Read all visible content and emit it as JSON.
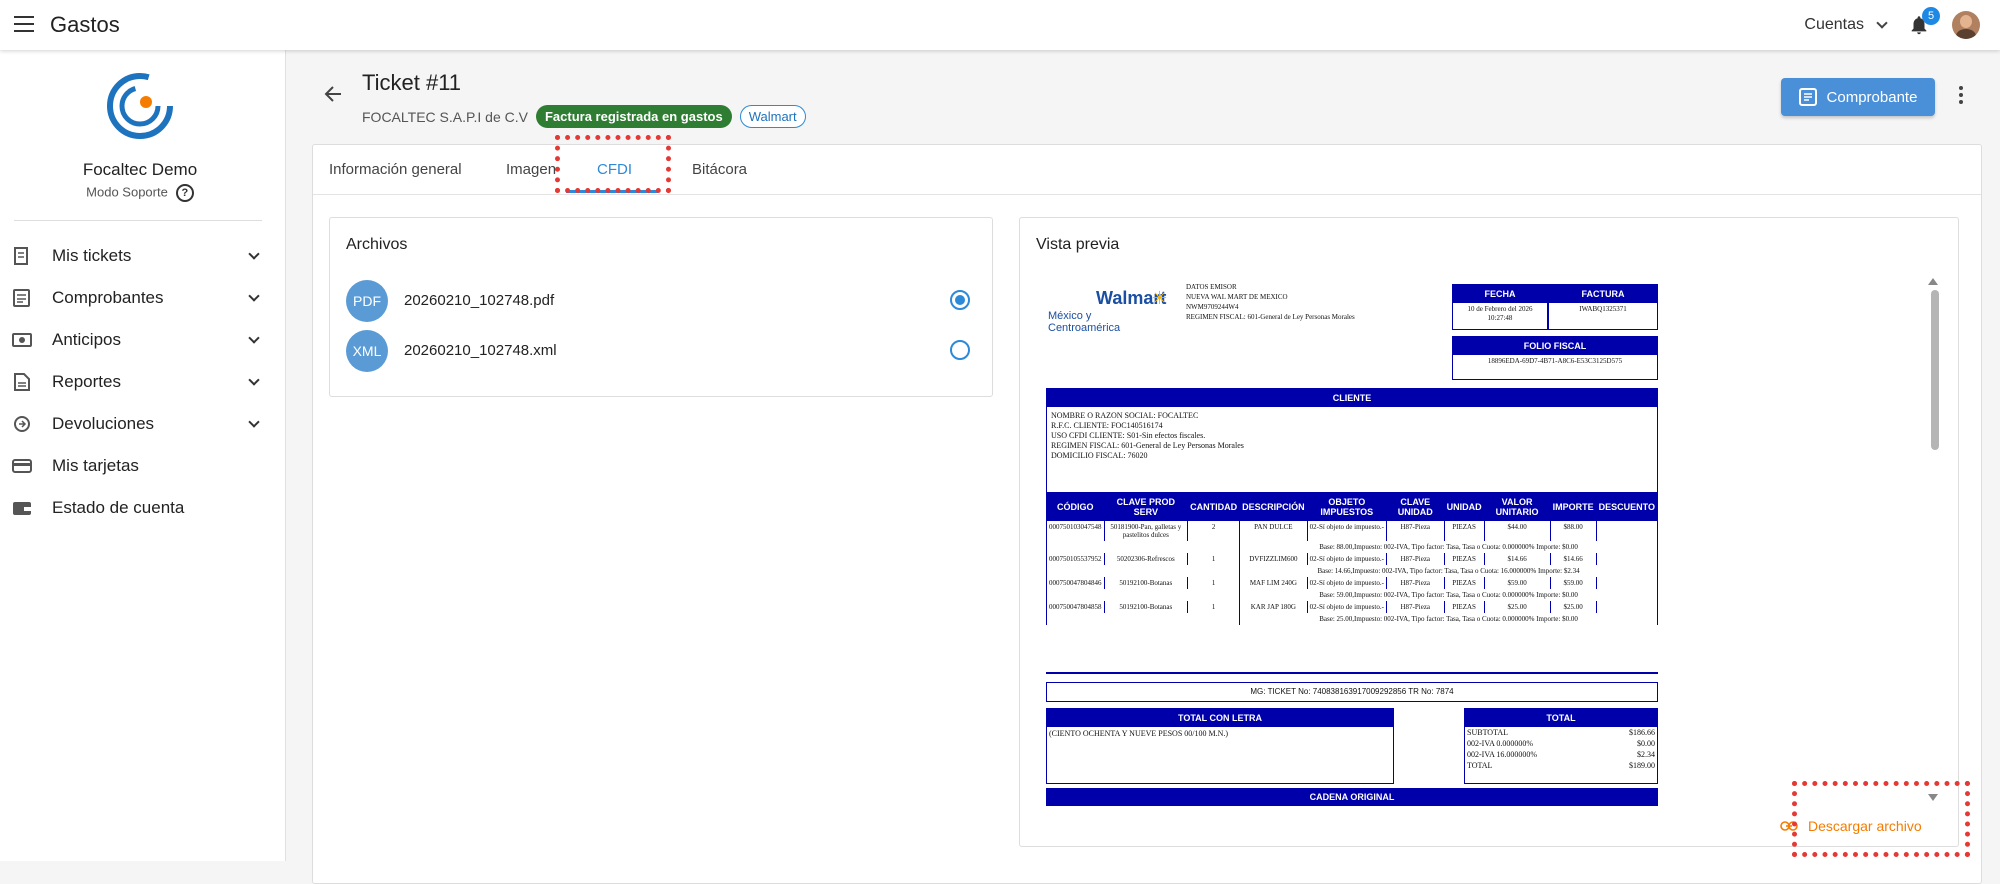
{
  "app": {
    "title": "Gastos"
  },
  "topbar": {
    "accounts_label": "Cuentas",
    "notifications_count": "5"
  },
  "sidebar": {
    "org_name": "Focaltec Demo",
    "mode": "Modo Soporte",
    "help": "?",
    "items": [
      {
        "label": "Mis tickets",
        "icon": "receipt-icon",
        "expandable": true
      },
      {
        "label": "Comprobantes",
        "icon": "document-icon",
        "expandable": true
      },
      {
        "label": "Anticipos",
        "icon": "cash-icon",
        "expandable": true
      },
      {
        "label": "Reportes",
        "icon": "report-icon",
        "expandable": true
      },
      {
        "label": "Devoluciones",
        "icon": "refund-icon",
        "expandable": true
      },
      {
        "label": "Mis tarjetas",
        "icon": "card-icon",
        "expandable": false
      },
      {
        "label": "Estado de cuenta",
        "icon": "wallet-icon",
        "expandable": false
      }
    ]
  },
  "header": {
    "title": "Ticket #11",
    "company": "FOCALTEC S.A.P.I de C.V",
    "status_chip": "Factura registrada en gastos",
    "vendor_chip": "Walmart",
    "comprobante_button": "Comprobante"
  },
  "tabs": [
    {
      "label": "Información general",
      "active": false
    },
    {
      "label": "Imagen",
      "active": false
    },
    {
      "label": "CFDI",
      "active": true
    },
    {
      "label": "Bitácora",
      "active": false
    }
  ],
  "files": {
    "title": "Archivos",
    "items": [
      {
        "type": "PDF",
        "name": "20260210_102748.pdf",
        "selected": true
      },
      {
        "type": "XML",
        "name": "20260210_102748.xml",
        "selected": false
      }
    ]
  },
  "preview": {
    "title": "Vista previa",
    "download_label": "Descargar archivo",
    "invoice": {
      "logo_text": "Walmart",
      "logo_sub": "México y Centroamérica",
      "emisor_lines": [
        "DATOS EMISOR",
        "NUEVA WAL MART DE MEXICO",
        "NWM9709244W4",
        "REGIMEN FISCAL: 601-General de Ley Personas Morales"
      ],
      "fecha_label": "FECHA",
      "fecha_value": "10 de Febrero del 2026 10:27:48",
      "factura_label": "FACTURA",
      "factura_value": "IWABQ1325371",
      "folio_label": "FOLIO FISCAL",
      "folio_value": "18896EDA-69D7-4B71-A8C6-E53C3125D575",
      "cliente_label": "CLIENTE",
      "cliente_lines": [
        "NOMBRE O RAZON SOCIAL: FOCALTEC",
        "R.F.C. CLIENTE: FOC140516174",
        "USO CFDI CLIENTE: S01-Sin efectos fiscales.",
        "REGIMEN FISCAL: 601-General de Ley Personas Morales",
        "DOMICILIO FISCAL: 76020"
      ],
      "columns": [
        "CÓDIGO",
        "CLAVE PROD SERV",
        "CANTIDAD",
        "DESCRIPCIÓN",
        "OBJETO IMPUESTOS",
        "CLAVE UNIDAD",
        "UNIDAD",
        "VALOR UNITARIO",
        "IMPORTE",
        "DESCUENTO"
      ],
      "rows": [
        {
          "codigo": "000750103047548",
          "clave": "50181900-Pan, galletas y pastelitos dulces",
          "cantidad": "2",
          "desc": "PAN DULCE",
          "objeto": "02-Sí objeto de impuesto.-",
          "clave_unidad": "H87-Pieza",
          "unidad": "PIEZAS",
          "valor": "$44.00",
          "importe": "$88.00",
          "descuento": "",
          "base": "Base: 88.00,Impuesto: 002-IVA, Tipo factor: Tasa, Tasa o Cuota: 0.000000% Importe: $0.00"
        },
        {
          "codigo": "000750105537952",
          "clave": "50202306-Refrescos",
          "cantidad": "1",
          "desc": "DVFIZZLIM600",
          "objeto": "02-Sí objeto de impuesto.-",
          "clave_unidad": "H87-Pieza",
          "unidad": "PIEZAS",
          "valor": "$14.66",
          "importe": "$14.66",
          "descuento": "",
          "base": "Base: 14.66,Impuesto: 002-IVA, Tipo factor: Tasa, Tasa o Cuota: 16.000000% Importe: $2.34"
        },
        {
          "codigo": "000750047804846",
          "clave": "50192100-Botanas",
          "cantidad": "1",
          "desc": "MAF LIM 240G",
          "objeto": "02-Sí objeto de impuesto.-",
          "clave_unidad": "H87-Pieza",
          "unidad": "PIEZAS",
          "valor": "$59.00",
          "importe": "$59.00",
          "descuento": "",
          "base": "Base: 59.00,Impuesto: 002-IVA, Tipo factor: Tasa, Tasa o Cuota: 0.000000% Importe: $0.00"
        },
        {
          "codigo": "000750047804858",
          "clave": "50192100-Botanas",
          "cantidad": "1",
          "desc": "KAR JAP 180G",
          "objeto": "02-Sí objeto de impuesto.-",
          "clave_unidad": "H87-Pieza",
          "unidad": "PIEZAS",
          "valor": "$25.00",
          "importe": "$25.00",
          "descuento": "",
          "base": "Base: 25.00,Impuesto: 002-IVA, Tipo factor: Tasa, Tasa o Cuota: 0.000000% Importe: $0.00"
        }
      ],
      "mg_line": "MG: TICKET No: 74083816391700929​2856 TR No: 7874",
      "letra_label": "TOTAL CON LETRA",
      "letra_value": "(CIENTO OCHENTA Y NUEVE PESOS 00/100 M.N.)",
      "total_label": "TOTAL",
      "totals": [
        {
          "label": "SUBTOTAL",
          "value": "$186.66"
        },
        {
          "label": "002-IVA 0.000000%",
          "value": "$0.00"
        },
        {
          "label": "002-IVA 16.000000%",
          "value": "$2.34"
        },
        {
          "label": "TOTAL",
          "value": "$189.00"
        }
      ],
      "cadena_label": "CADENA ORIGINAL"
    }
  },
  "colors": {
    "primary": "#2d8ad8",
    "success": "#2e7d32",
    "invoice_blue": "#0000aa",
    "download": "#f57c00",
    "highlight": "#e53935"
  }
}
